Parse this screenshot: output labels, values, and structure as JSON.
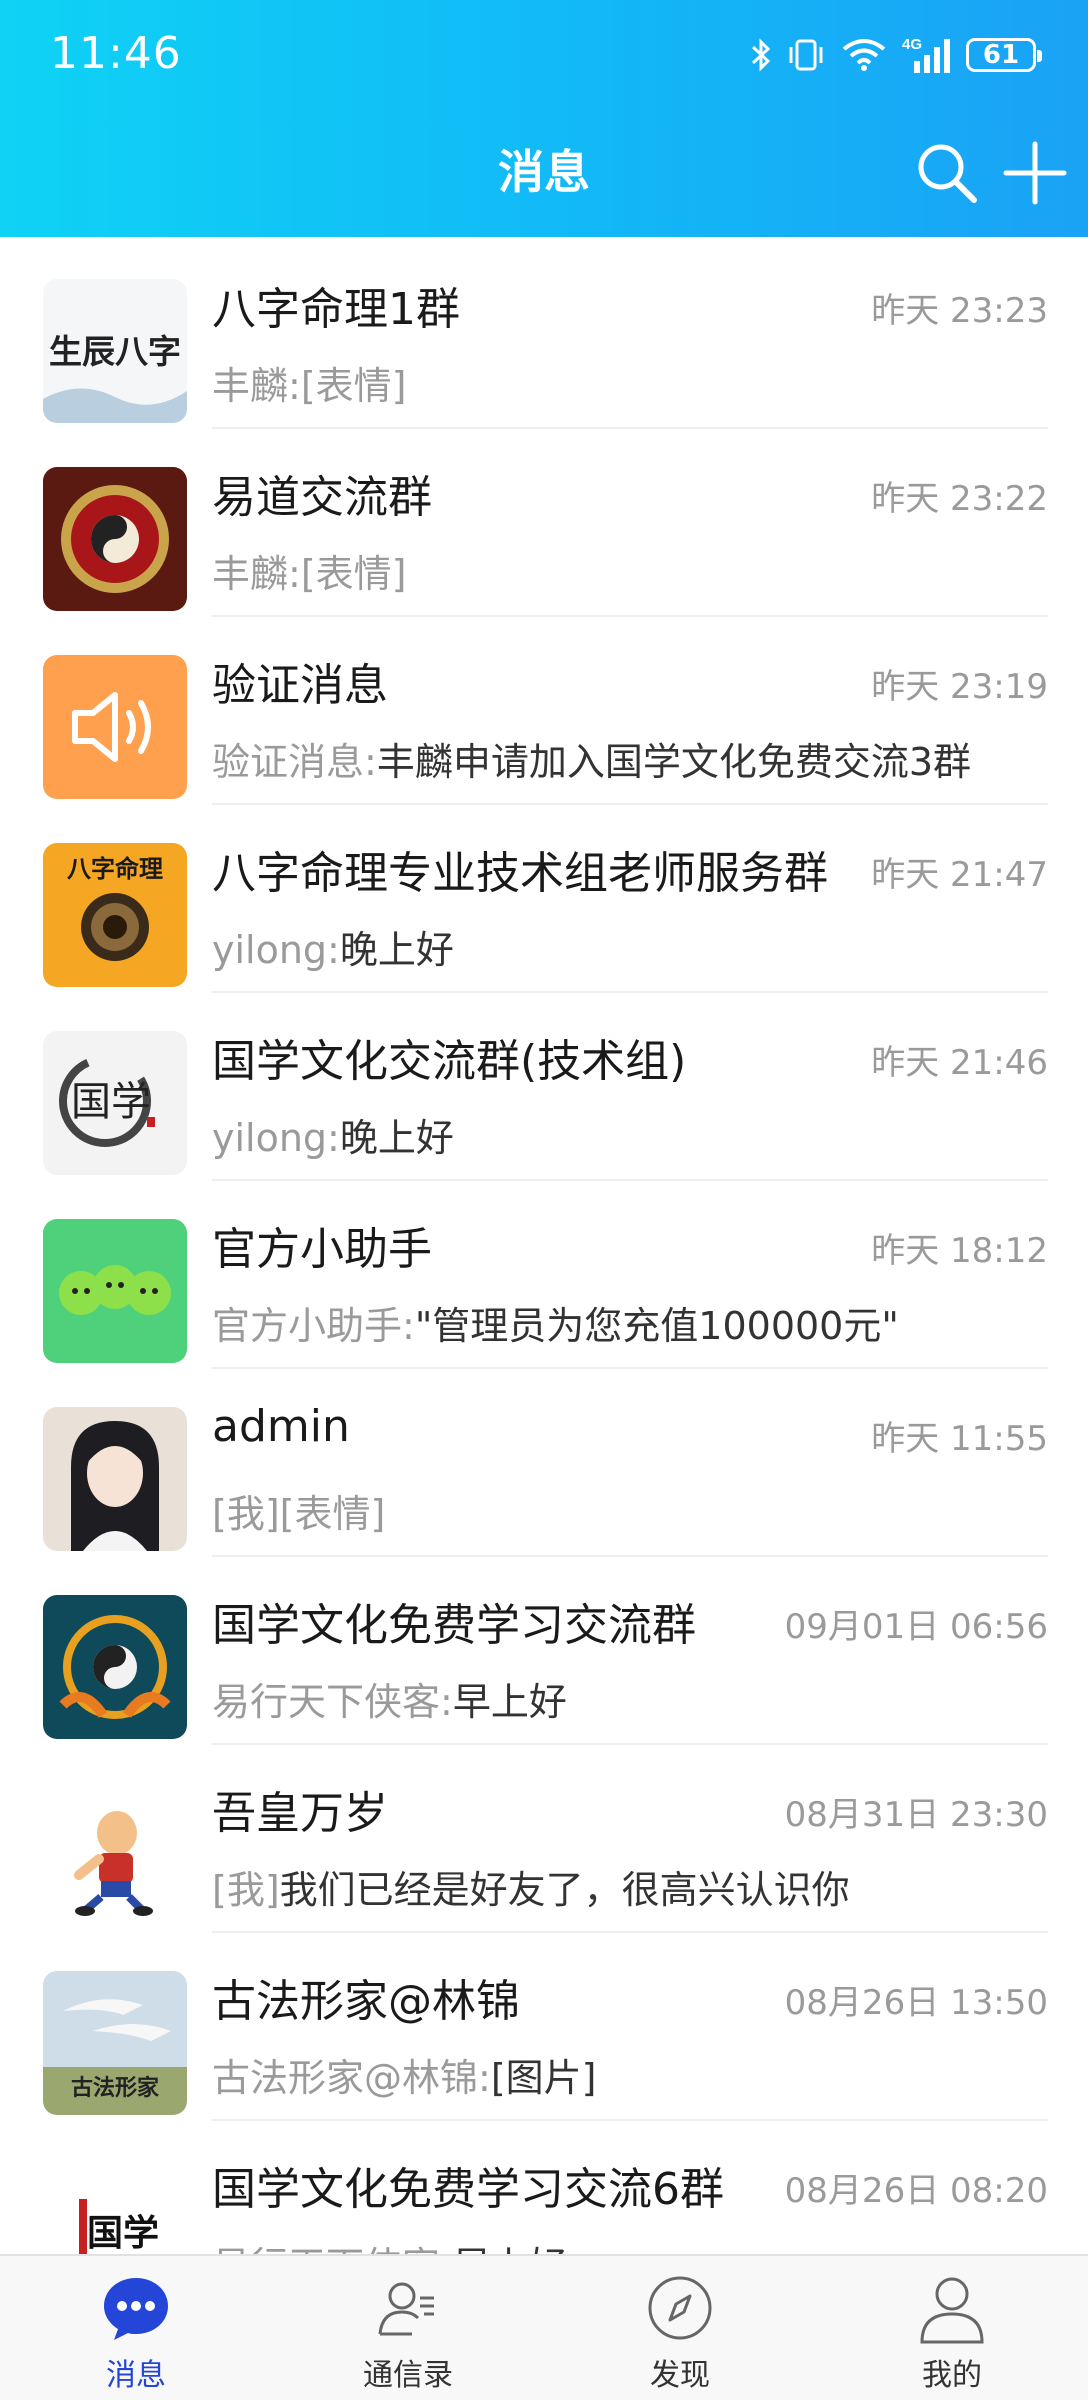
{
  "status_bar": {
    "time": "11:46",
    "network": "4G",
    "battery": "61"
  },
  "header": {
    "title": "消息",
    "search_icon": "search-icon",
    "add_icon": "plus-icon"
  },
  "chats": [
    {
      "name": "八字命理1群",
      "time": "昨天 23:23",
      "sender": "丰麟:",
      "message": "[表情]",
      "avatar_text": "生辰八字"
    },
    {
      "name": "易道交流群",
      "time": "昨天 23:22",
      "sender": "丰麟:",
      "message": "[表情]",
      "avatar_text": ""
    },
    {
      "name": "验证消息",
      "time": "昨天 23:19",
      "sender": "验证消息:",
      "message": "丰麟申请加入国学文化免费交流3群",
      "avatar_text": ""
    },
    {
      "name": "八字命理专业技术组老师服务群",
      "time": "昨天 21:47",
      "sender": "yilong:",
      "message": "晚上好",
      "avatar_text": "八字命理"
    },
    {
      "name": "国学文化交流群(技术组)",
      "time": "昨天 21:46",
      "sender": "yilong:",
      "message": "晚上好",
      "avatar_text": "国学"
    },
    {
      "name": "官方小助手",
      "time": "昨天 18:12",
      "sender": "官方小助手:",
      "message": "\"管理员为您充值100000元\"",
      "avatar_text": ""
    },
    {
      "name": "admin",
      "time": "昨天 11:55",
      "sender": "[我]",
      "message": "[表情]",
      "avatar_text": ""
    },
    {
      "name": "国学文化免费学习交流群",
      "time": "09月01日 06:56",
      "sender": "易行天下侠客:",
      "message": "早上好",
      "avatar_text": ""
    },
    {
      "name": "吾皇万岁",
      "time": "08月31日 23:30",
      "sender": "[我]",
      "message": "我们已经是好友了，很高兴认识你",
      "avatar_text": ""
    },
    {
      "name": "古法形家@林锦",
      "time": "08月26日 13:50",
      "sender": "古法形家@林锦:",
      "message": "[图片]",
      "avatar_text": "古法形家"
    },
    {
      "name": "国学文化免费学习交流6群",
      "time": "08月26日 08:20",
      "sender": "易行天下侠客:",
      "message": "早上好",
      "avatar_text": "国学"
    }
  ],
  "tabbar": [
    {
      "label": "消息",
      "icon": "chat-bubble-icon",
      "active": true
    },
    {
      "label": "通信录",
      "icon": "contacts-icon",
      "active": false
    },
    {
      "label": "发现",
      "icon": "compass-icon",
      "active": false
    },
    {
      "label": "我的",
      "icon": "person-icon",
      "active": false
    }
  ],
  "colors": {
    "header_start": "#0fd2f5",
    "header_end": "#1aa2f5",
    "active_tab": "#2446d8",
    "muted_text": "#9a9a9a"
  }
}
